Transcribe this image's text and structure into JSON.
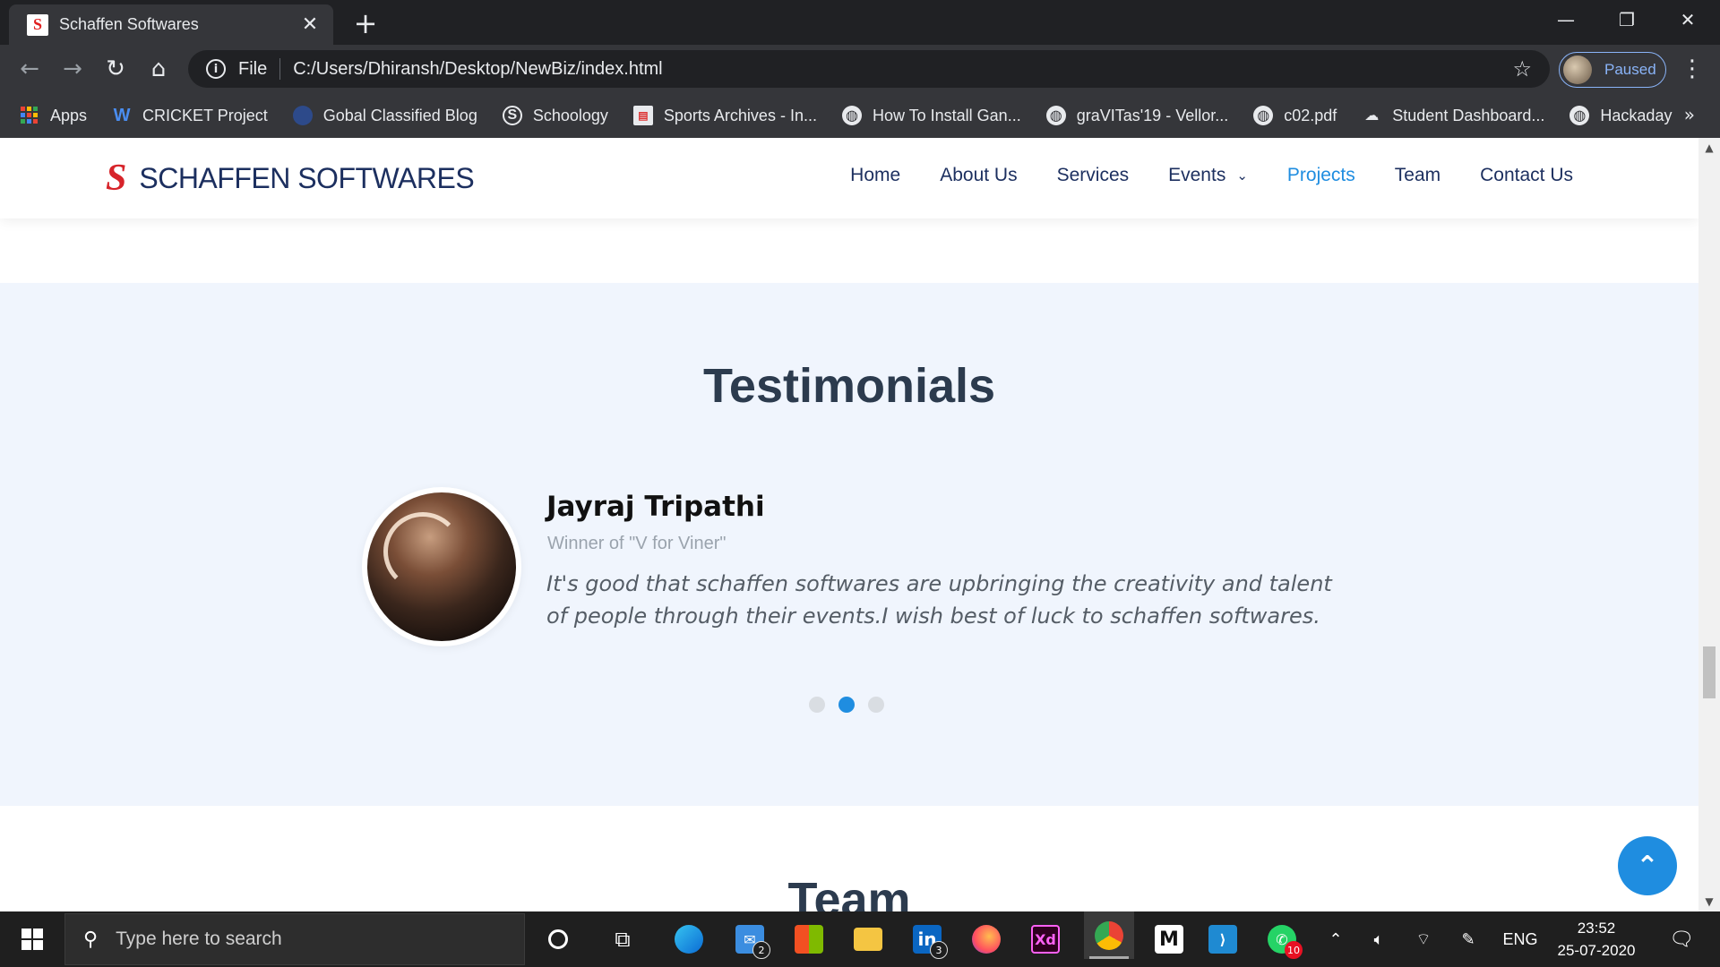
{
  "browser": {
    "tab": {
      "title": "Schaffen Softwares",
      "favicon": "S"
    },
    "address": {
      "scheme": "File",
      "url": "C:/Users/Dhiransh/Desktop/NewBiz/index.html"
    },
    "profile_label": "Paused",
    "bookmarks": [
      {
        "label": "Apps",
        "icon": "apps-icon"
      },
      {
        "label": "CRICKET Project",
        "icon": "w-icon"
      },
      {
        "label": "Gobal Classified Blog",
        "icon": "blog-icon"
      },
      {
        "label": "Schoology",
        "icon": "schoology-icon"
      },
      {
        "label": "Sports Archives - In...",
        "icon": "sports-icon"
      },
      {
        "label": "How To Install Gan...",
        "icon": "globe-icon"
      },
      {
        "label": "graVITas'19 - Vellor...",
        "icon": "globe-icon"
      },
      {
        "label": "c02.pdf",
        "icon": "globe-icon"
      },
      {
        "label": "Student Dashboard...",
        "icon": "dashboard-icon"
      },
      {
        "label": "Hackaday",
        "icon": "globe-icon"
      }
    ],
    "more_glyph": "»"
  },
  "site": {
    "logo_mark": "S",
    "logo_text": "SCHAFFEN SOFTWARES",
    "nav": [
      {
        "label": "Home",
        "active": false
      },
      {
        "label": "About Us",
        "active": false
      },
      {
        "label": "Services",
        "active": false
      },
      {
        "label": "Events",
        "active": false,
        "dropdown": true
      },
      {
        "label": "Projects",
        "active": true
      },
      {
        "label": "Team",
        "active": false
      },
      {
        "label": "Contact Us",
        "active": false
      }
    ],
    "accent_color": "#1f8de0",
    "brand_color": "#1c2f5f"
  },
  "testimonials": {
    "title": "Testimonials",
    "name": "Jayraj Tripathi",
    "role": "Winner of \"V for Viner\"",
    "quote": "It's good that schaffen softwares are upbringing the creativity and talent of people through their events.I wish best of luck to schaffen softwares.",
    "slide_count": 3,
    "active_slide": 2
  },
  "team": {
    "title": "Team"
  },
  "taskbar": {
    "search_placeholder": "Type here to search",
    "mail_badge": "2",
    "linkedin_badge": "3",
    "whatsapp_badge": "10",
    "xd_label": "Xd",
    "language": "ENG",
    "time": "23:52",
    "date": "25-07-2020"
  }
}
